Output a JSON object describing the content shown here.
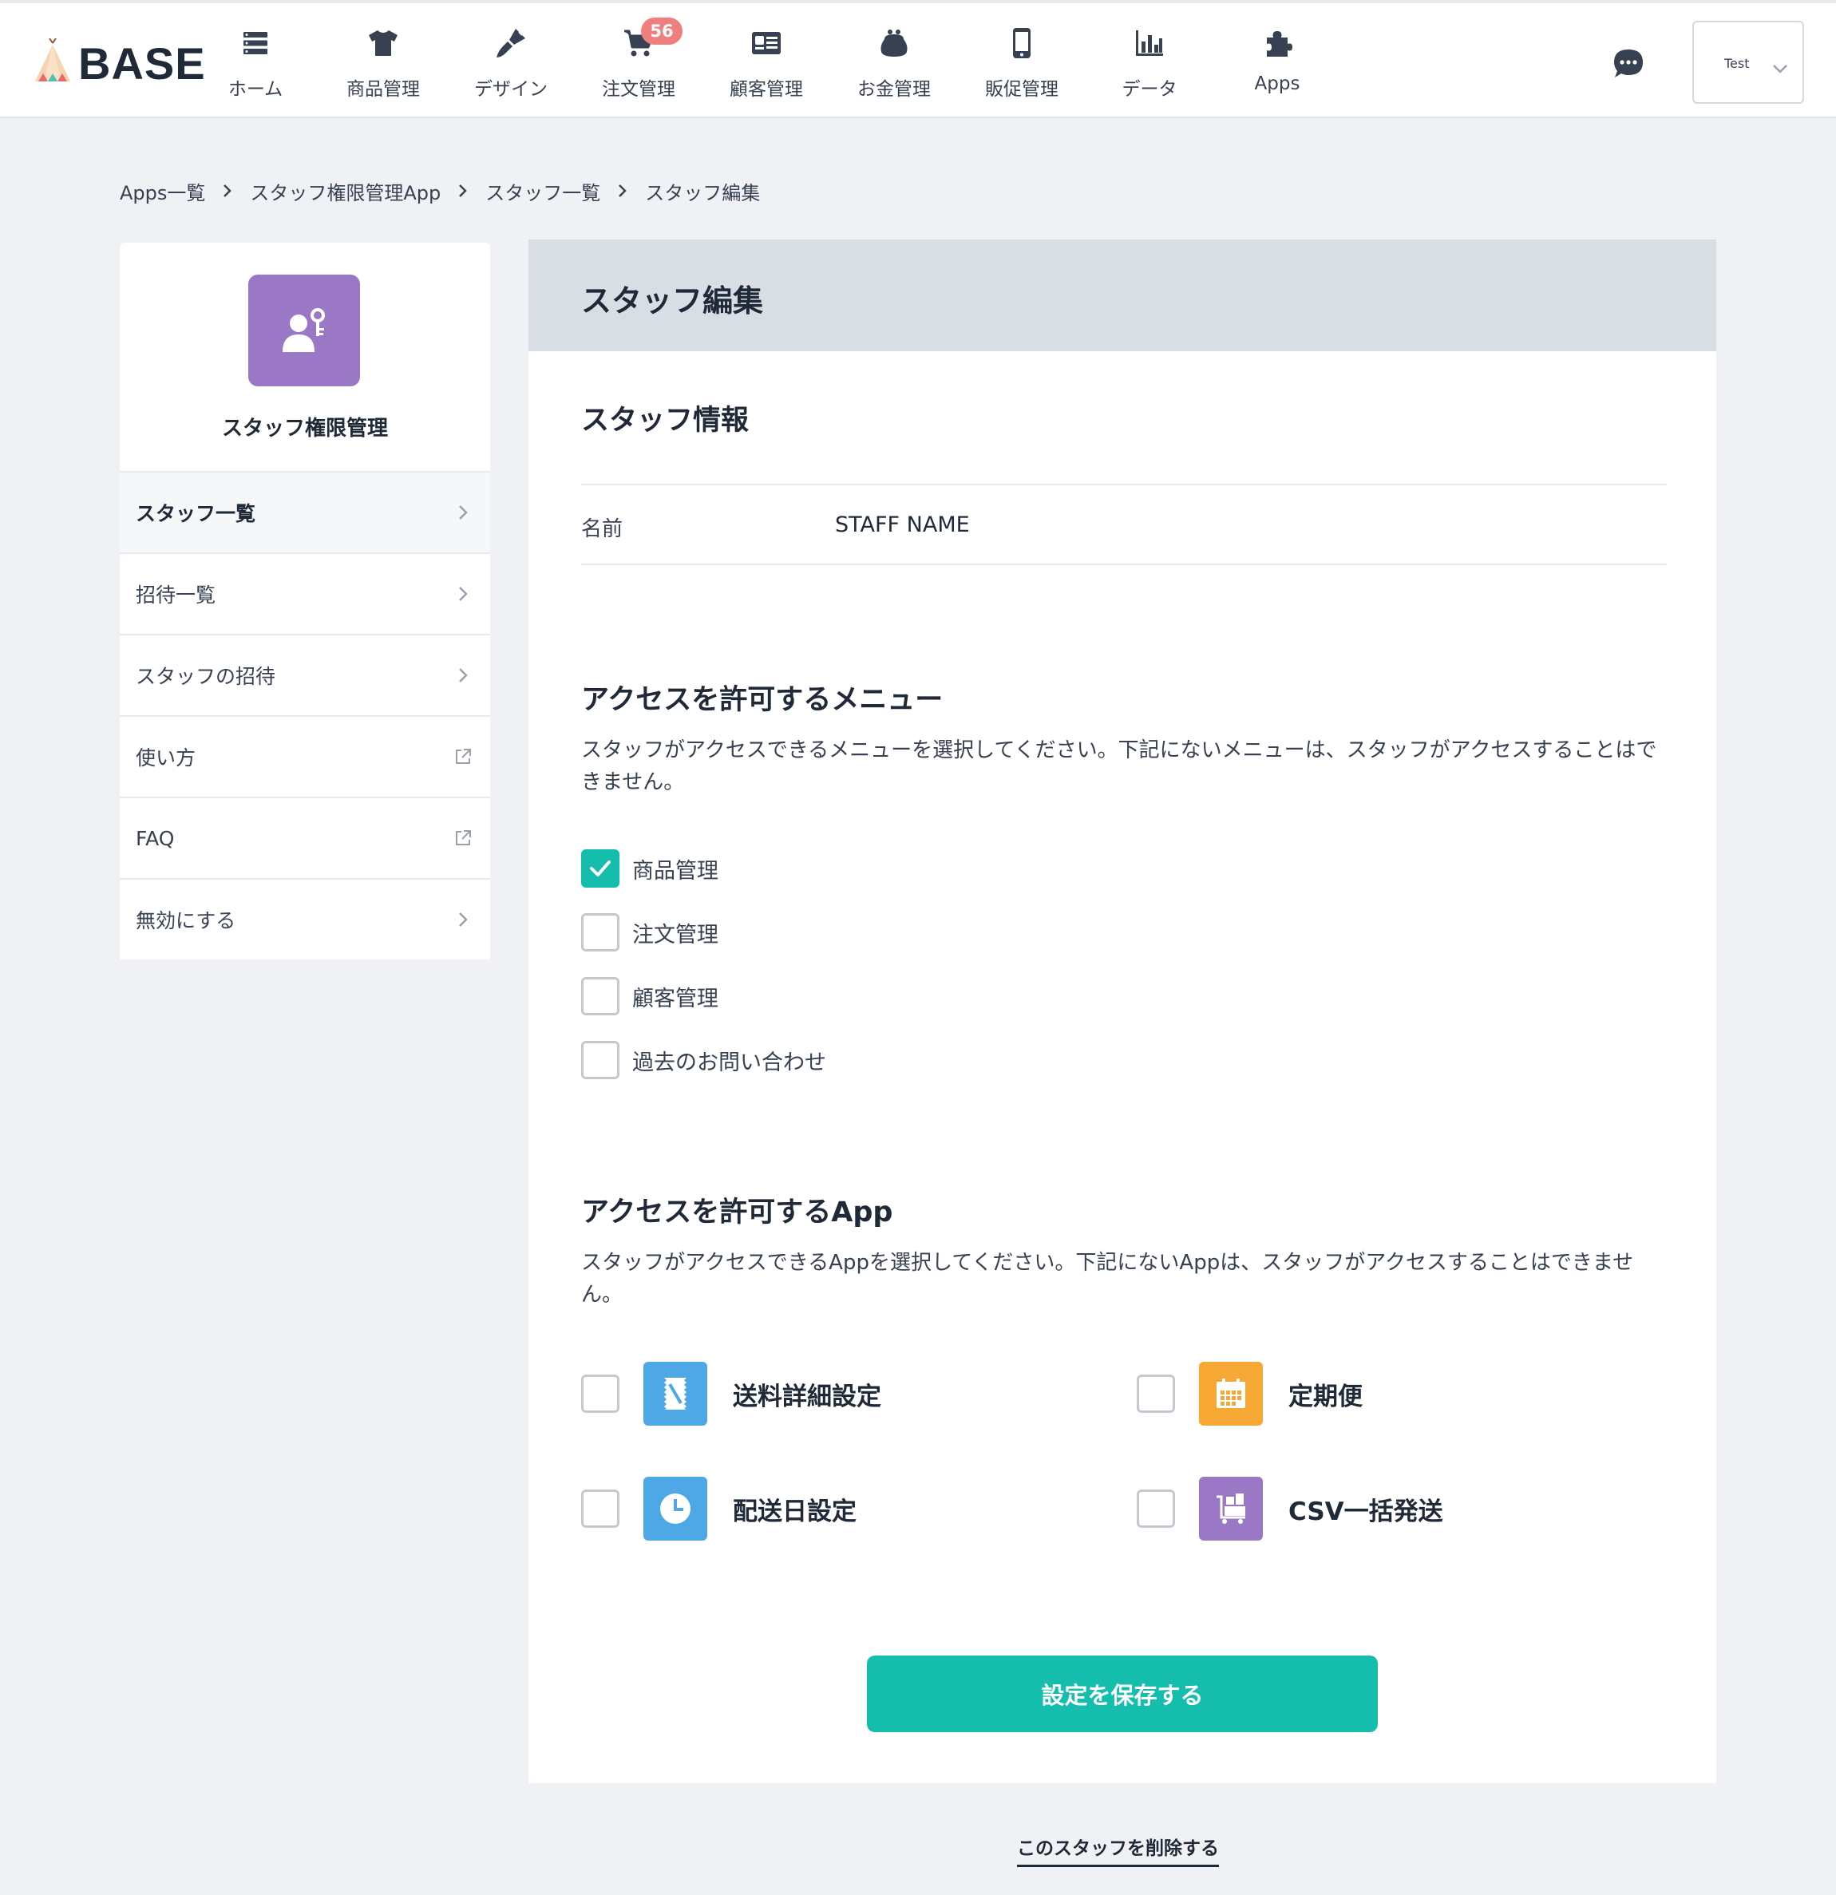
{
  "header": {
    "logo_text": "BASE",
    "nav": [
      {
        "label": "ホーム",
        "icon": "home-list-icon"
      },
      {
        "label": "商品管理",
        "icon": "tshirt-icon"
      },
      {
        "label": "デザイン",
        "icon": "brush-icon"
      },
      {
        "label": "注文管理",
        "icon": "cart-icon",
        "badge": "56"
      },
      {
        "label": "顧客管理",
        "icon": "id-card-icon"
      },
      {
        "label": "お金管理",
        "icon": "purse-icon"
      },
      {
        "label": "販促管理",
        "icon": "smartphone-icon"
      },
      {
        "label": "データ",
        "icon": "bar-chart-icon"
      },
      {
        "label": "Apps",
        "icon": "puzzle-icon"
      }
    ],
    "account_name": "Test"
  },
  "breadcrumb": [
    "Apps一覧",
    "スタッフ権限管理App",
    "スタッフ一覧",
    "スタッフ編集"
  ],
  "sidebar": {
    "app_name": "スタッフ権限管理",
    "items": [
      {
        "label": "スタッフ一覧",
        "icon": "chevron-right-icon"
      },
      {
        "label": "招待一覧",
        "icon": "chevron-right-icon"
      },
      {
        "label": "スタッフの招待",
        "icon": "chevron-right-icon"
      },
      {
        "label": "使い方",
        "icon": "external-link-icon"
      },
      {
        "label": "FAQ",
        "icon": "external-link-icon"
      },
      {
        "label": "無効にする",
        "icon": "chevron-right-icon"
      }
    ]
  },
  "main": {
    "title": "スタッフ編集",
    "staff_info": {
      "title": "スタッフ情報",
      "name_label": "名前",
      "name_value": "STAFF NAME"
    },
    "menu_access": {
      "title": "アクセスを許可するメニュー",
      "description": "スタッフがアクセスできるメニューを選択してください。下記にないメニューは、スタッフがアクセスすることはできません。",
      "options": [
        {
          "label": "商品管理",
          "checked": true
        },
        {
          "label": "注文管理",
          "checked": false
        },
        {
          "label": "顧客管理",
          "checked": false
        },
        {
          "label": "過去のお問い合わせ",
          "checked": false
        }
      ]
    },
    "app_access": {
      "title": "アクセスを許可するApp",
      "description": "スタッフがアクセスできるAppを選択してください。下記にないAppは、スタッフがアクセスすることはできません。",
      "apps": [
        {
          "label": "送料詳細設定",
          "checked": false,
          "icon": "shipping-stamp-icon",
          "color": "#4ea8e6"
        },
        {
          "label": "定期便",
          "checked": false,
          "icon": "calendar-icon",
          "color": "#f7a734"
        },
        {
          "label": "配送日設定",
          "checked": false,
          "icon": "clock-icon",
          "color": "#4ea8e6"
        },
        {
          "label": "CSV一括発送",
          "checked": false,
          "icon": "cart-boxes-icon",
          "color": "#9b78c6"
        }
      ]
    },
    "save_label": "設定を保存する",
    "delete_label": "このスタッフを削除する"
  },
  "colors": {
    "accent": "#14bdac",
    "badge": "#ef7f7f",
    "app_tile": "#9b78c6",
    "header_bg": "#d9dde4",
    "page_bg": "#eff1f4"
  }
}
